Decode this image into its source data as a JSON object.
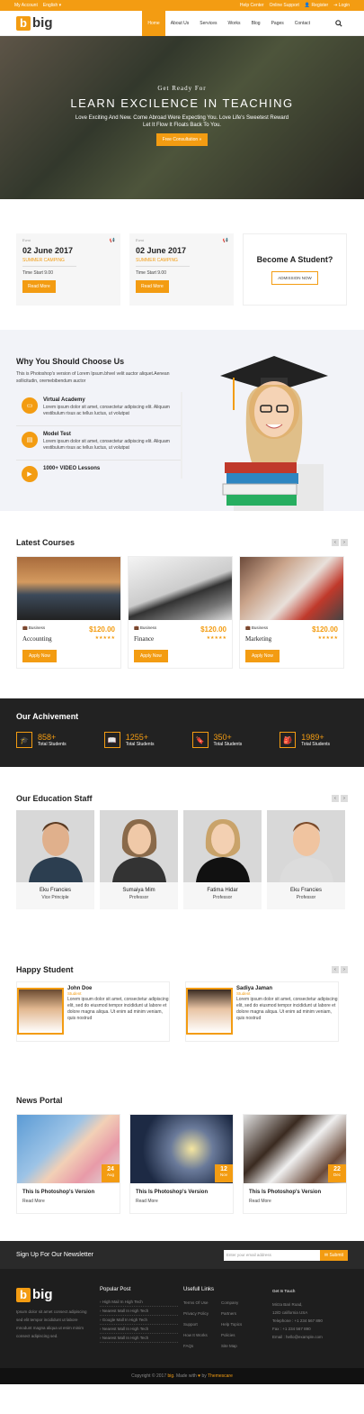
{
  "topbar": {
    "account": "My Account",
    "language": "English",
    "help": "Help Center",
    "support": "Online Support",
    "register": "Register",
    "login": "Login"
  },
  "brand": {
    "letter": "b",
    "name": "big"
  },
  "menu": [
    "Home",
    "About Us",
    "Services",
    "Works",
    "Blog",
    "Pages",
    "Contact"
  ],
  "hero": {
    "subtitle": "Get Ready For",
    "title": "LEARN EXCILENCE IN TEACHING",
    "text": "Love Exciting And New. Come Abroad Were Expecting You. Love Life's Sweetest Reward Let It Flow It Floats Back To You.",
    "button": "Free Consultation »"
  },
  "events": [
    {
      "label": "Event",
      "date": "02 June 2017",
      "category": "SUMMER CAMPING",
      "time": "Time Start 9.00",
      "button": "Read More"
    },
    {
      "label": "Event",
      "date": "02 June 2017",
      "category": "SUMMER CAMPING",
      "time": "Time Start 9.00",
      "button": "Read More"
    }
  ],
  "become": {
    "title": "Become A Student?",
    "button": "ADMISSION NOW"
  },
  "why": {
    "title": "Why You Should Choose Us",
    "text": "This is Photoshop's version of Lorem Ipsum.bhvel velit auctor aliquet.Aenean sollicitudin, oremebibendum auctor",
    "items": [
      {
        "title": "Virtual Academy",
        "text": "Lorem ipsum dolor sit amet, consectetur adipiscing elit. Aliquam vestibulum risus ac tellus luctus, ut volutpat"
      },
      {
        "title": "Model Test",
        "text": "Lorem ipsum dolor sit amet, consectetur adipiscing elit. Aliquam vestibulum risus ac tellus luctus, ut volutpat"
      },
      {
        "title": "1000+ VIDEO Lessons",
        "text": ""
      }
    ]
  },
  "courses": {
    "title": "Latest Courses",
    "items": [
      {
        "category": "Business",
        "price": "$120.00",
        "name": "Accounting",
        "button": "Apply Now"
      },
      {
        "category": "Business",
        "price": "$120.00",
        "name": "Finance",
        "button": "Apply Now"
      },
      {
        "category": "Business",
        "price": "$120.00",
        "name": "Marketing",
        "button": "Apply Now"
      }
    ]
  },
  "achievement": {
    "title": "Our Achivement",
    "items": [
      {
        "value": "858+",
        "label": "Total Students"
      },
      {
        "value": "1255+",
        "label": "Total Students"
      },
      {
        "value": "350+",
        "label": "Total Students"
      },
      {
        "value": "1989+",
        "label": "Total Students"
      }
    ]
  },
  "staff": {
    "title": "Our Education Staff",
    "items": [
      {
        "name": "Eku Francies",
        "role": "Vice Principle"
      },
      {
        "name": "Sumaiya Mim",
        "role": "Professor"
      },
      {
        "name": "Fatima Hidar",
        "role": "Professor"
      },
      {
        "name": "Eku Francies",
        "role": "Professor"
      }
    ]
  },
  "happy": {
    "title": "Happy Student",
    "items": [
      {
        "name": "John Doe",
        "role": "Student",
        "text": "Lorem ipsum dolor sit amet, consectetur adipiscing elit, sed do eiusmod tempor incididunt ut labore et dolore magna aliqua. Ut enim ad minim veniam, quis nostrud"
      },
      {
        "name": "Sadiya Jaman",
        "role": "Student",
        "text": "Lorem ipsum dolor sit amet, consectetur adipiscing elit, sed do eiusmod tempor incididunt ut labore et dolore magna aliqua. Ut enim ad minim veniam, quis nostrud"
      }
    ]
  },
  "news": {
    "title": "News Portal",
    "items": [
      {
        "day": "24",
        "month": "Aug",
        "title": "This Is Photoshop's Version",
        "more": "Read More"
      },
      {
        "day": "12",
        "month": "Nov",
        "title": "This Is Photoshop's Version",
        "more": "Read More"
      },
      {
        "day": "22",
        "month": "Dec",
        "title": "This Is Photoshop's Version",
        "more": "Read More"
      }
    ]
  },
  "newsletter": {
    "title": "Sign Up For Our Newsletter",
    "placeholder": "Enter your email address",
    "button": "Submit"
  },
  "footer": {
    "about": "Ipsum dolor sit amet consect adipiscing sed elit tempor incididunt ut labore mnodunt magna aliqua ut enim minim consect adipiscing sed.",
    "popular_title": "Popular Post",
    "popular": [
      "High Mail In High Tech",
      "Nearest Mall In High Tech",
      "Google Mall In High Tech",
      "Nearest Mall In High Tech",
      "Nearest Mall In High Tech"
    ],
    "links_title": "Usefull Links",
    "links_a": [
      "Terms Of Use",
      "Privacy Policy",
      "Support",
      "How It Works",
      "FAQs"
    ],
    "links_b": [
      "Company",
      "Partners",
      "Help Topics",
      "Policies",
      "Site Map"
    ],
    "contact_title": "Get In Touch",
    "contact": [
      "Mirza Bari Road,",
      "12/D california USA",
      "Telephone : +1 234 567 890",
      "Fax : +1 234 567 890",
      "Email : hello@example.com"
    ]
  },
  "copyright": {
    "pre": "Copyright © 2017",
    "brand": "big",
    "mid": ". Made with",
    "by": "by",
    "author": "Themescare"
  },
  "colors": {
    "accent": "#f39c12",
    "dark": "#222222"
  }
}
